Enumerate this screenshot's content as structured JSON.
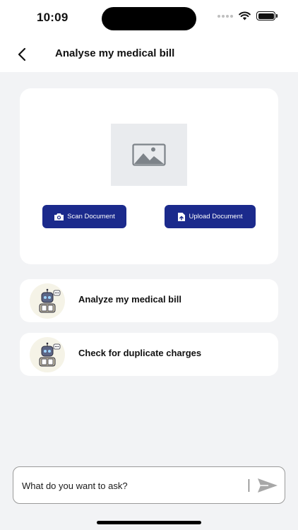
{
  "status_bar": {
    "time": "10:09"
  },
  "header": {
    "title": "Analyse my medical bill",
    "back_icon": "chevron-left-icon"
  },
  "upload_card": {
    "placeholder_icon": "image-placeholder-icon",
    "scan_label": "Scan Document",
    "scan_icon": "camera-icon",
    "upload_label": "Upload Document",
    "upload_icon": "file-upload-icon",
    "button_color": "#1b2a8c"
  },
  "suggestions": [
    {
      "label": "Analyze my medical bill",
      "icon": "robot-avatar-icon"
    },
    {
      "label": "Check for duplicate charges",
      "icon": "robot-avatar-icon"
    }
  ],
  "chat": {
    "placeholder": "What do you want to ask?",
    "send_icon": "send-icon"
  },
  "colors": {
    "background": "#f2f3f5",
    "card": "#ffffff",
    "accent": "#1b2a8c"
  }
}
